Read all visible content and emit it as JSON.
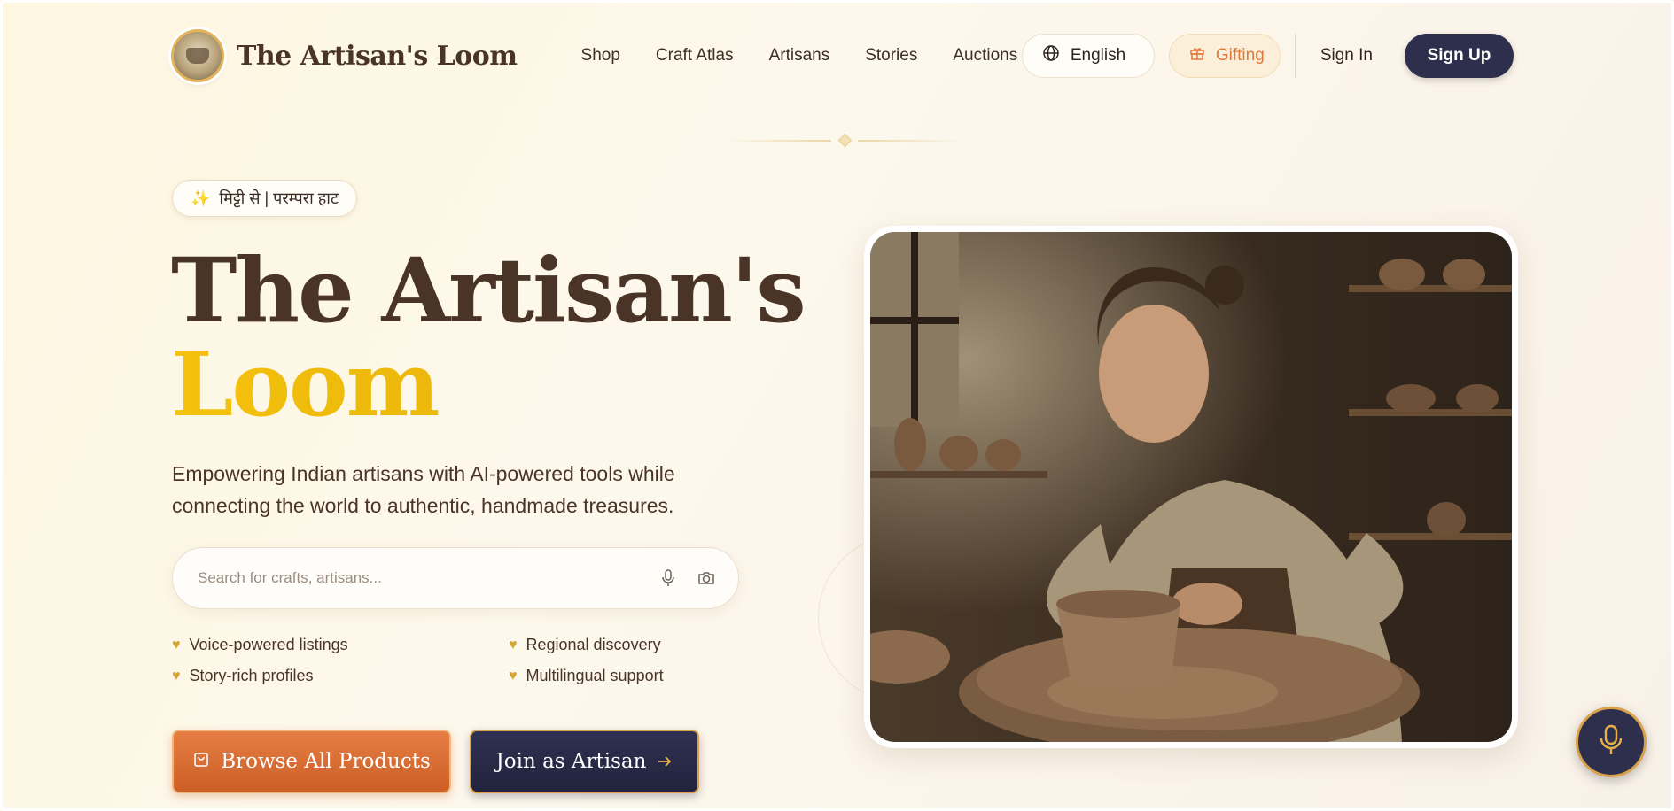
{
  "brand": {
    "name": "The Artisan's Loom",
    "logo_icon": "emblem-icon"
  },
  "nav": {
    "items": [
      {
        "label": "Shop"
      },
      {
        "label": "Craft Atlas"
      },
      {
        "label": "Artisans"
      },
      {
        "label": "Stories"
      },
      {
        "label": "Auctions"
      }
    ]
  },
  "header": {
    "language_label": "English",
    "gifting_label": "Gifting",
    "signin_label": "Sign In",
    "signup_label": "Sign Up"
  },
  "hero": {
    "tag": "मिट्टी से | परम्परा हाट",
    "title_line1": "The Artisan's",
    "title_line2": "Loom",
    "description": "Empowering Indian artisans with AI-powered tools while connecting the world to authentic, handmade treasures.",
    "search": {
      "placeholder": "Search for crafts, artisans...",
      "value": ""
    },
    "features": [
      {
        "label": "Voice-powered listings"
      },
      {
        "label": "Regional discovery"
      },
      {
        "label": "Story-rich profiles"
      },
      {
        "label": "Multilingual support"
      }
    ],
    "browse_label": "Browse All Products",
    "join_label": "Join as Artisan"
  },
  "colors": {
    "accent": "#2e2f4d",
    "brand_brown": "#4a3428",
    "gold": "#f4c20d",
    "orange": "#e07a3c"
  },
  "icons": {
    "language": "globe-icon",
    "gifting": "gift-icon",
    "tag": "sparkle-icon",
    "search_voice": "microphone-icon",
    "search_camera": "camera-icon",
    "feature": "heart-icon",
    "browse": "shopping-bag-icon",
    "join": "arrow-right-icon",
    "fab": "microphone-icon"
  }
}
